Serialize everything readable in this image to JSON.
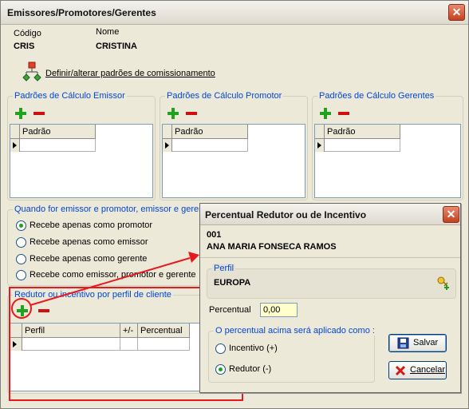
{
  "window": {
    "title": "Emissores/Promotores/Gerentes",
    "close": "✕"
  },
  "header": {
    "codigo_label": "Código",
    "codigo_value": "CRIS",
    "nome_label": "Nome",
    "nome_value": "CRISTINA"
  },
  "commission_link": {
    "label": "Definir/alterar padrões de comissionamento"
  },
  "panels": [
    {
      "title": "Padrões de Cálculo Emissor",
      "column": "Padrão"
    },
    {
      "title": "Padrões de Cálculo  Promotor",
      "column": "Padrão"
    },
    {
      "title": "Padrões de Cálculo Gerentes",
      "column": "Padrão"
    }
  ],
  "role_group": {
    "title": "Quando for emissor e promotor, emissor e gerente",
    "options": [
      "Recebe apenas como promotor",
      "Recebe apenas como emissor",
      "Recebe apenas como gerente",
      "Recebe como emissor, promotor e gerente"
    ],
    "selected": 0
  },
  "redutor_group": {
    "title": "Redutor ou incentivo por perfil de cliente",
    "columns": [
      "Perfil",
      "+/-",
      "Percentual"
    ]
  },
  "dialog": {
    "title": "Percentual Redutor ou de Incentivo",
    "close": "✕",
    "code": "001",
    "name": "ANA MARIA FONSECA RAMOS",
    "perfil_label": "Perfil",
    "perfil_value": "EUROPA",
    "percentual_label": "Percentual",
    "percentual_value": "0,00",
    "applied_group_title": "O percentual acima será aplicado como :",
    "applied_options": [
      "Incentivo (+)",
      "Redutor (-)"
    ],
    "applied_selected": 1,
    "save_label": "Salvar",
    "cancel_label": "Cancelar"
  },
  "colors": {
    "accent": "#0046d5",
    "annotation": "#e8191e",
    "add": "#1fa31f",
    "remove": "#d01010"
  }
}
